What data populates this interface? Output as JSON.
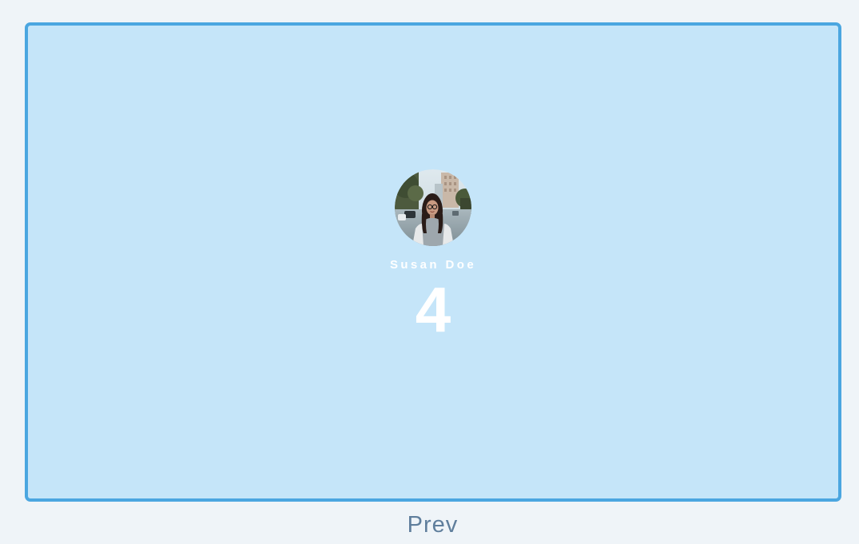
{
  "card": {
    "profile": {
      "name": "Susan Doe",
      "count": "4",
      "avatar_icon": "person-photo"
    }
  },
  "navigation": {
    "prev_label": "Prev"
  },
  "colors": {
    "page_background": "#eff4f8",
    "card_background": "#c5e5f9",
    "card_border": "#4ba6e0",
    "text_white": "#ffffff",
    "prev_text": "#5f7e9c"
  }
}
